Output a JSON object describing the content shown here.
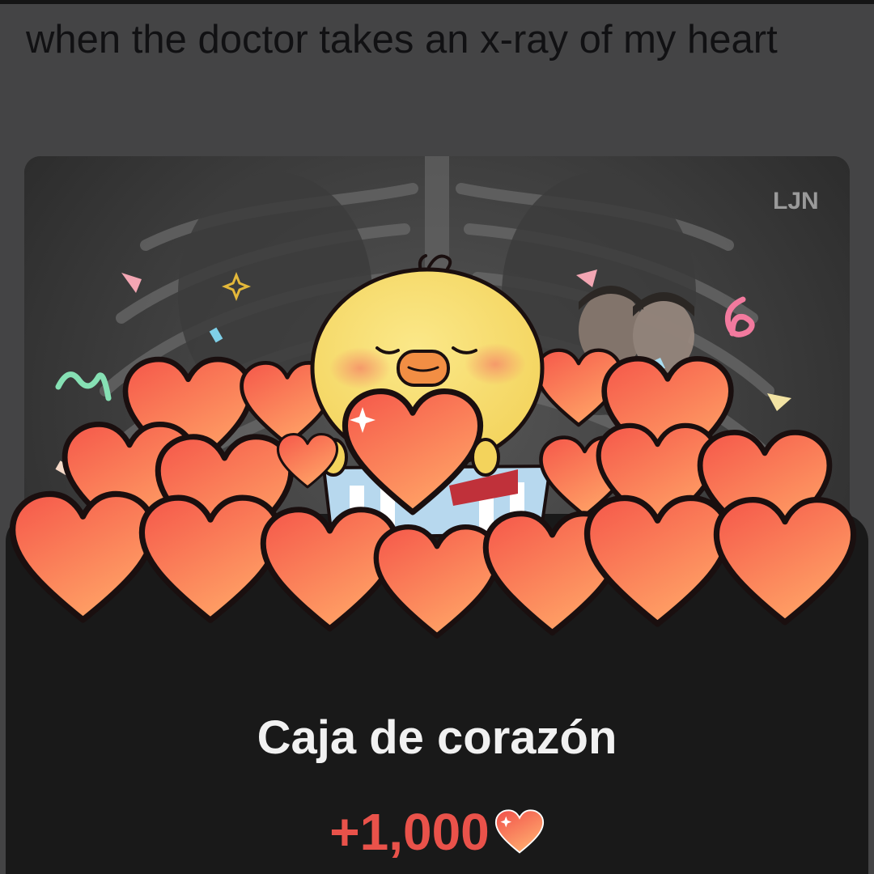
{
  "post": {
    "title": "when the doctor takes an x-ray of my heart",
    "image_watermark": "LJN"
  },
  "reward": {
    "title": "Caja de corazón",
    "amount": "+1,000",
    "amount_icon": "heart-icon"
  },
  "colors": {
    "sheet_background": "#191919",
    "title_text": "#f1f1f1",
    "amount_text": "#e9524a",
    "heart_gradient_top": "#f5574a",
    "heart_gradient_bottom": "#ffa266",
    "chick_yellow": "#f8df73",
    "page_dim": "#444445"
  }
}
